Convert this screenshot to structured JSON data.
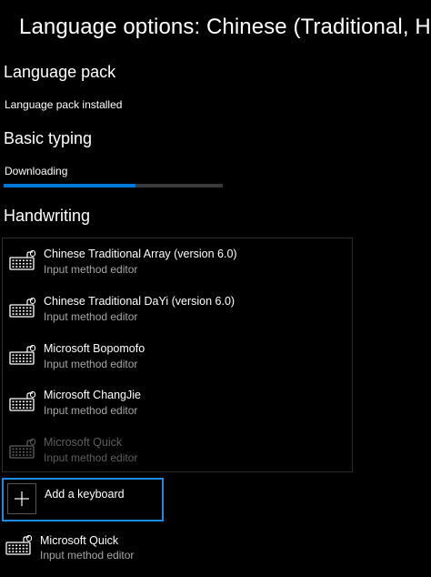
{
  "header": {
    "title": "Language options: Chinese (Traditional, Hong Kong SAR)"
  },
  "language_pack": {
    "title": "Language pack",
    "status": "Language pack installed"
  },
  "basic_typing": {
    "title": "Basic typing",
    "status": "Downloading",
    "progress_fraction": 0.6
  },
  "handwriting": {
    "title": "Handwriting"
  },
  "keyboards": [
    {
      "name": "Chinese Traditional Array (version 6.0)",
      "type": "Input method editor",
      "enabled": true
    },
    {
      "name": "Chinese Traditional DaYi (version 6.0)",
      "type": "Input method editor",
      "enabled": true
    },
    {
      "name": "Microsoft Bopomofo",
      "type": "Input method editor",
      "enabled": true
    },
    {
      "name": "Microsoft ChangJie",
      "type": "Input method editor",
      "enabled": true
    },
    {
      "name": "Microsoft Quick",
      "type": "Input method editor",
      "enabled": false
    }
  ],
  "add_keyboard": {
    "label": "Add a keyboard"
  },
  "dragged_item": {
    "name": "Microsoft Quick",
    "type": "Input method editor"
  },
  "colors": {
    "accent": "#0078d7",
    "focus_border": "#1a8ae5",
    "secondary_text": "#a6a6a6",
    "disabled_text": "#5e5e5e"
  }
}
